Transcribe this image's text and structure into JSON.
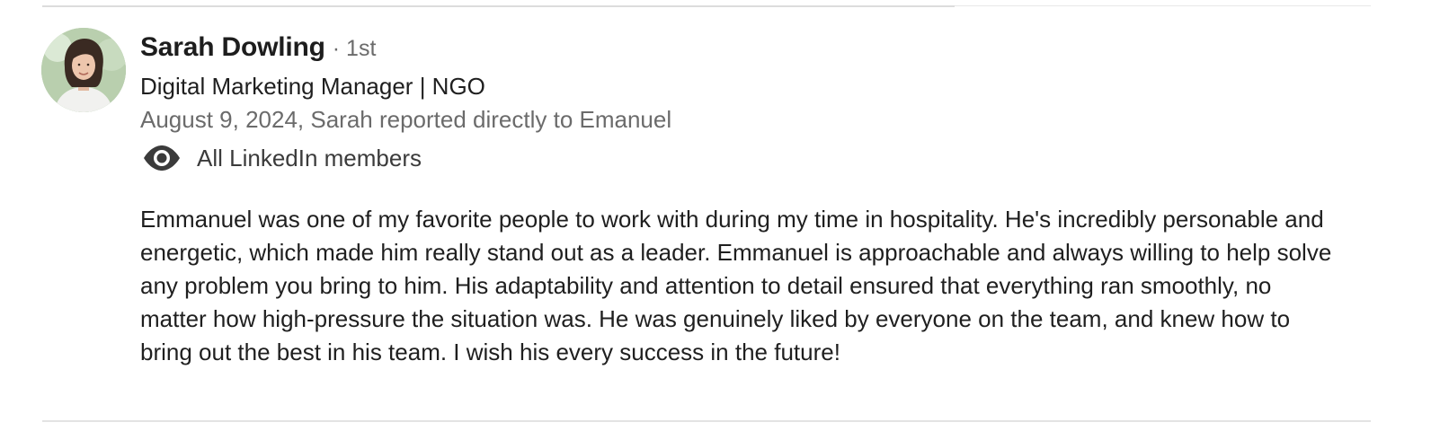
{
  "recommender": {
    "name": "Sarah Dowling",
    "connection_degree": "· 1st",
    "headline": "Digital Marketing Manager | NGO",
    "relationship": "August 9, 2024, Sarah reported directly to Emanuel",
    "avatar_icon": "profile-photo"
  },
  "visibility": {
    "icon": "eye-icon",
    "label": "All LinkedIn members"
  },
  "recommendation": {
    "text": "Emmanuel was one of my favorite people to work with during my time in hospitality. He's incredibly personable and energetic, which made him really stand out as a leader. Emmanuel is approachable and always willing to help solve any problem you bring to him. His adaptability and attention to detail ensured that everything ran smoothly, no matter how high-pressure the situation was. He was genuinely liked by everyone on the team, and knew how to bring out the best in his team. I wish his every success in the future!"
  },
  "colors": {
    "name": "#1d1d1d",
    "secondary_text": "#6b6b6b",
    "body_text": "#1f1f1f",
    "divider": "#e3e3e3"
  }
}
